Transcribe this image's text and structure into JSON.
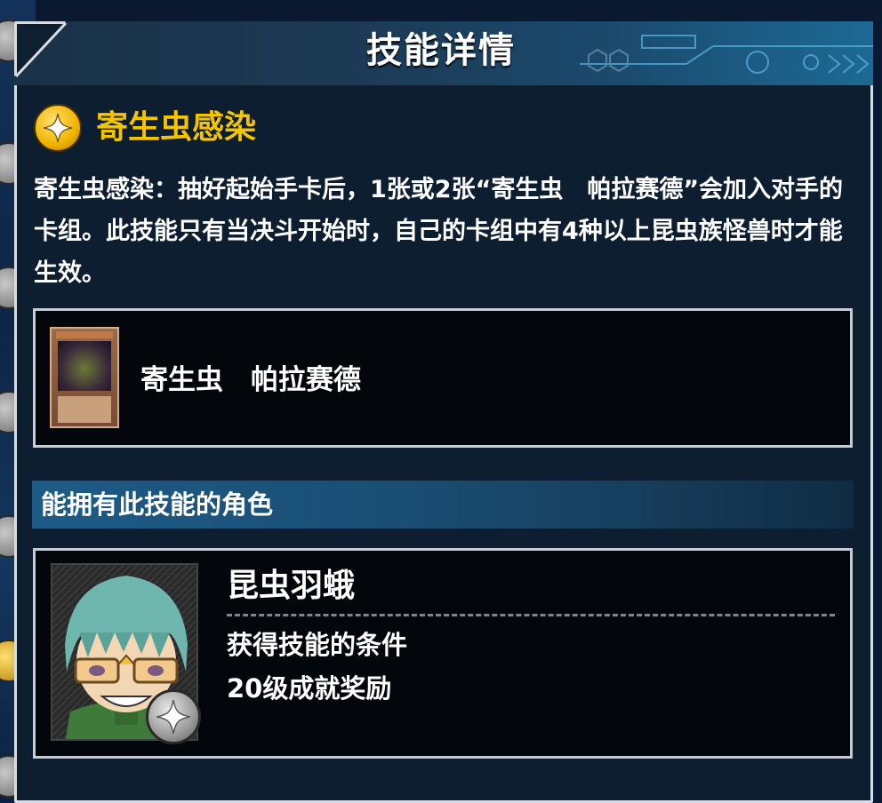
{
  "header": {
    "title": "技能详情"
  },
  "skill": {
    "icon": "star-sparkle-icon",
    "name": "寄生虫感染",
    "description": "寄生虫感染：抽好起始手卡后，1张或2张“寄生虫　帕拉赛德”会加入对手的卡组。此技能只有当决斗开始时，自己的卡组中有4种以上昆虫族怪兽时才能生效。"
  },
  "related_card": {
    "name": "寄生虫　帕拉赛德"
  },
  "characters_section": {
    "title": "能拥有此技能的角色",
    "character": {
      "name": "昆虫羽蛾",
      "condition_label": "获得技能的条件",
      "condition_value": "20级成就奖励",
      "rank_icon": "silver-star-icon"
    }
  },
  "colors": {
    "skill_name": "#f4c400",
    "panel_bg": "#0d1e30",
    "box_border": "#c8ccd2",
    "section_bar": "#1d5b86"
  }
}
